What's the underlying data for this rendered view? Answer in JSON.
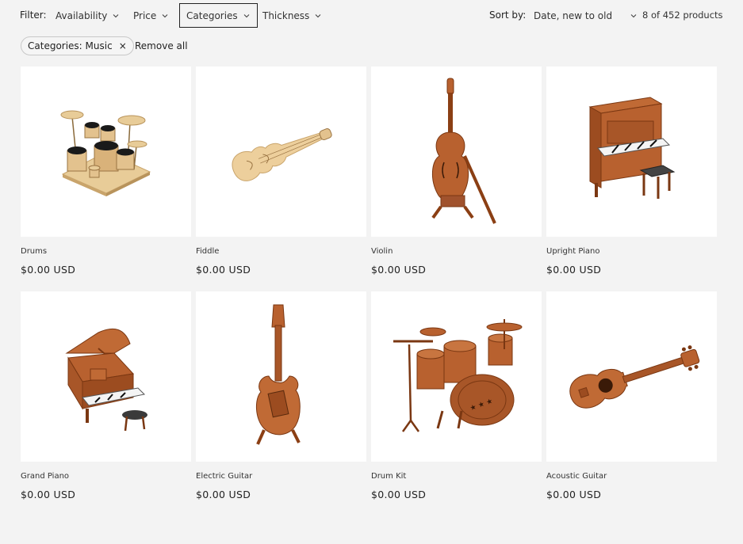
{
  "filters": {
    "label": "Filter:",
    "items": [
      {
        "label": "Availability"
      },
      {
        "label": "Price"
      },
      {
        "label": "Categories"
      },
      {
        "label": "Thickness"
      }
    ]
  },
  "sort": {
    "label": "Sort by:",
    "selected": "Date, new to old"
  },
  "count": "8 of 452 products",
  "active_filter": {
    "label": "Categories: Music",
    "remove_icon": "×"
  },
  "remove_all": "Remove all",
  "products": [
    {
      "title": "Drums",
      "price": "$0.00 USD",
      "icon": "drums-image"
    },
    {
      "title": "Fiddle",
      "price": "$0.00 USD",
      "icon": "fiddle-image"
    },
    {
      "title": "Violin",
      "price": "$0.00 USD",
      "icon": "violin-image"
    },
    {
      "title": "Upright Piano",
      "price": "$0.00 USD",
      "icon": "upright-piano-image"
    },
    {
      "title": "Grand Piano",
      "price": "$0.00 USD",
      "icon": "grand-piano-image"
    },
    {
      "title": "Electric Guitar",
      "price": "$0.00 USD",
      "icon": "electric-guitar-image"
    },
    {
      "title": "Drum Kit",
      "price": "$0.00 USD",
      "icon": "drum-kit-image"
    },
    {
      "title": "Acoustic Guitar",
      "price": "$0.00 USD",
      "icon": "acoustic-guitar-image"
    }
  ],
  "colors": {
    "background": "#f3f3f3",
    "card": "#ffffff",
    "light_wood": "#e3c28e",
    "dark_wood": "#b8612f"
  }
}
